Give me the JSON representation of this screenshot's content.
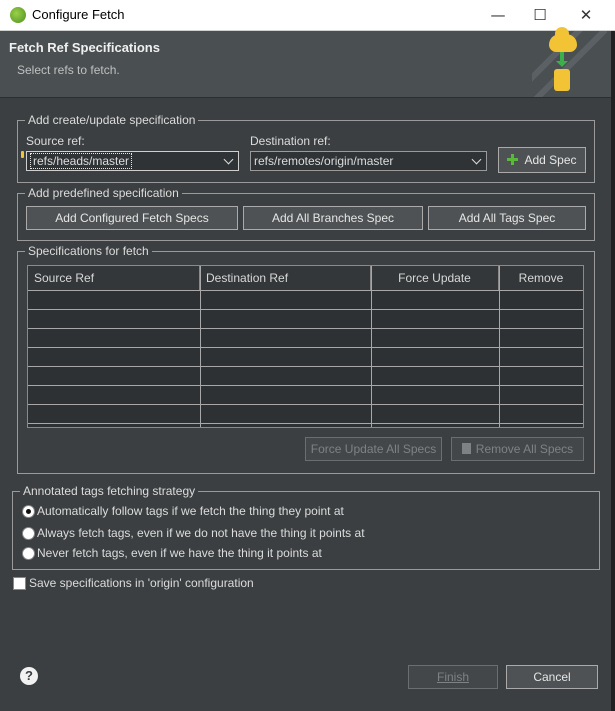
{
  "window": {
    "title": "Configure Fetch",
    "controls": [
      "—",
      "☐",
      "✕"
    ]
  },
  "header": {
    "title": "Fetch Ref Specifications",
    "subtitle": "Select refs to fetch."
  },
  "create_group": {
    "label": "Add create/update specification",
    "source_label": "Source ref:",
    "source_value": "refs/heads/master",
    "dest_label": "Destination ref:",
    "dest_value": "refs/remotes/origin/master",
    "add_spec_label": "Add Spec"
  },
  "predefined_group": {
    "label": "Add predefined specification",
    "buttons": [
      "Add Configured Fetch Specs",
      "Add All Branches Spec",
      "Add All Tags Spec"
    ]
  },
  "specs_group": {
    "label": "Specifications for fetch",
    "columns": [
      "Source Ref",
      "Destination Ref",
      "Force Update",
      "Remove"
    ],
    "rows": [],
    "force_all_label": "Force Update All Specs",
    "remove_all_label": "Remove All Specs"
  },
  "tags_group": {
    "label": "Annotated tags fetching strategy",
    "options": [
      "Automatically follow tags if we fetch the thing they point at",
      "Always fetch tags, even if we do not have the thing it points at",
      "Never fetch tags, even if we have the thing it points at"
    ],
    "selected_index": 0
  },
  "save_spec": {
    "label": "Save specifications in 'origin' configuration",
    "checked": false
  },
  "footer": {
    "help": "?",
    "finish_label": "Finish",
    "cancel_label": "Cancel"
  }
}
